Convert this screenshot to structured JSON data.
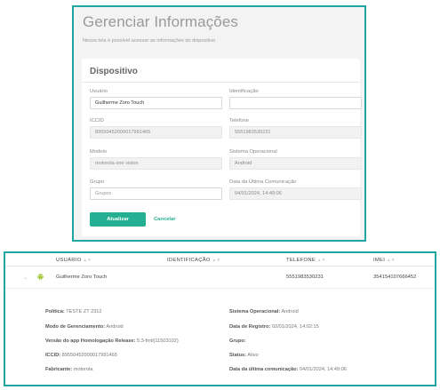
{
  "form": {
    "title": "Gerenciar Informações",
    "subtitle": "Nessa tela é possível acessar as informações do dispositivo",
    "card_title": "Dispositivo",
    "fields": {
      "usuario": {
        "label": "Usuário",
        "value": "Guilherme Zoro Touch"
      },
      "identificacao": {
        "label": "Identificação",
        "value": ""
      },
      "iccid": {
        "label": "ICCID",
        "value": "89550452000017991465"
      },
      "telefone": {
        "label": "Telefone",
        "value": "5551983530231"
      },
      "modelo": {
        "label": "Modelo",
        "value": "motorola one vision"
      },
      "sistema": {
        "label": "Sistema Operacional",
        "value": "Android"
      },
      "grupo": {
        "label": "Grupo",
        "value": "",
        "placeholder": "Grupos"
      },
      "ultima_comunicacao": {
        "label": "Data da Última Comunicação",
        "value": "04/01/2024, 14:49:06"
      }
    },
    "update_label": "Atualizar",
    "cancel_label": "Cancelar"
  },
  "table": {
    "headers": {
      "usuario": "USUÁRIO",
      "identificacao": "IDENTIFICAÇÃO",
      "telefone": "TELEFONE",
      "imei": "IMEI"
    },
    "row": {
      "icon": "android-icon",
      "usuario": "Guilherme Zoro Touch",
      "telefone": "5551983530231",
      "imei": "354154107666452"
    },
    "details_left": [
      {
        "label": "Política:",
        "value": "TESTE ZT 2312"
      },
      {
        "label": "Modo de Gerenciamento:",
        "value": "Android"
      },
      {
        "label": "Versão do app Homologação Release:",
        "value": "5.3-fmtl(11503102)"
      },
      {
        "label": "ICCID:",
        "value": "89550452000017991465"
      },
      {
        "label": "Fabricante:",
        "value": "motorola"
      }
    ],
    "details_right": [
      {
        "label": "Sistema Operacional:",
        "value": "Android"
      },
      {
        "label": "Data de Registro:",
        "value": "02/01/2024, 14:02:15"
      },
      {
        "label": "Grupo:",
        "value": ""
      },
      {
        "label": "Status:",
        "value": "Ativo"
      },
      {
        "label": "Data da última comunicação:",
        "value": "04/01/2024, 14:49:06"
      }
    ]
  },
  "colors": {
    "accent": "#1fa5a2",
    "button": "#25b094",
    "android": "#a4c639"
  }
}
